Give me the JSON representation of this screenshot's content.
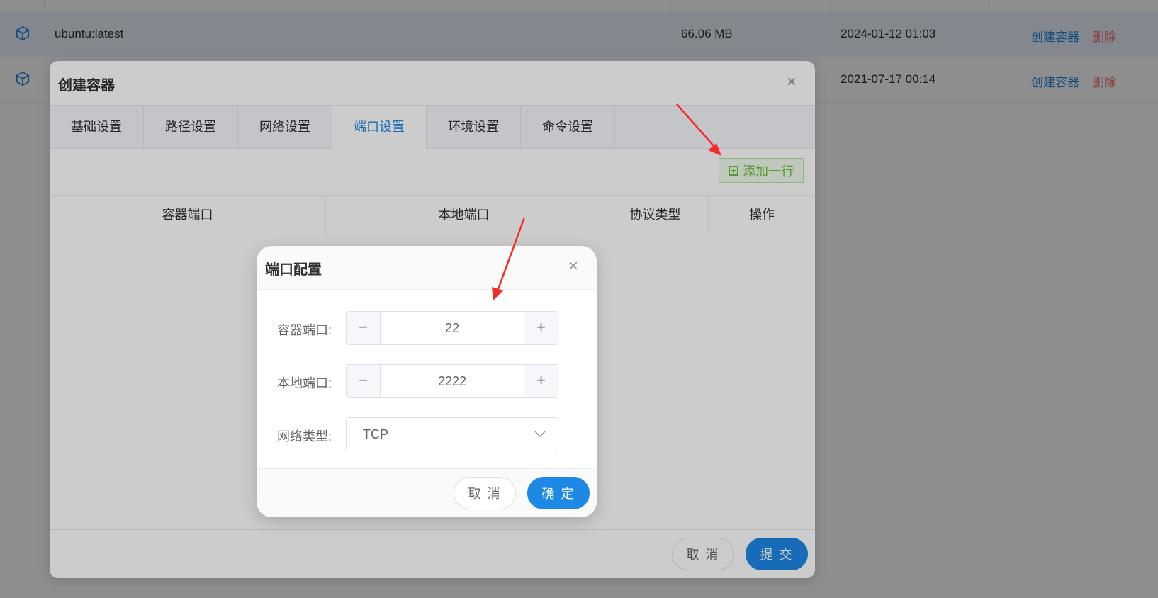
{
  "images": [
    {
      "name": "ubuntu:latest",
      "size": "66.06 MB",
      "date": "2024-01-12 01:03",
      "create_label": "创建容器",
      "delete_label": "删除"
    },
    {
      "name": "",
      "size": "",
      "date": "2021-07-17 00:14",
      "create_label": "创建容器",
      "delete_label": "删除"
    }
  ],
  "dialog": {
    "title": "创建容器",
    "close": "×",
    "tabs": [
      {
        "label": "基础设置"
      },
      {
        "label": "路径设置"
      },
      {
        "label": "网络设置"
      },
      {
        "label": "端口设置",
        "active": true
      },
      {
        "label": "环境设置"
      },
      {
        "label": "命令设置"
      }
    ],
    "add_row_label": "添加一行",
    "port_table_headers": [
      "容器端口",
      "本地端口",
      "协议类型",
      "操作"
    ],
    "cancel_label": "取 消",
    "submit_label": "提 交"
  },
  "port_dialog": {
    "title": "端口配置",
    "close": "×",
    "container_port_label": "容器端口:",
    "container_port_value": "22",
    "local_port_label": "本地端口:",
    "local_port_value": "2222",
    "network_type_label": "网络类型:",
    "network_type_value": "TCP",
    "minus": "−",
    "plus": "+",
    "cancel_label": "取 消",
    "confirm_label": "确 定"
  },
  "colors": {
    "accent": "#1e88e5",
    "danger": "#f56c6c",
    "success": "#67c23a",
    "annotation": "#f52a2a"
  },
  "icons": {
    "row_icon": "cube-icon",
    "add_row_icon": "plus-square-icon",
    "select_icon": "chevron-down-icon"
  }
}
